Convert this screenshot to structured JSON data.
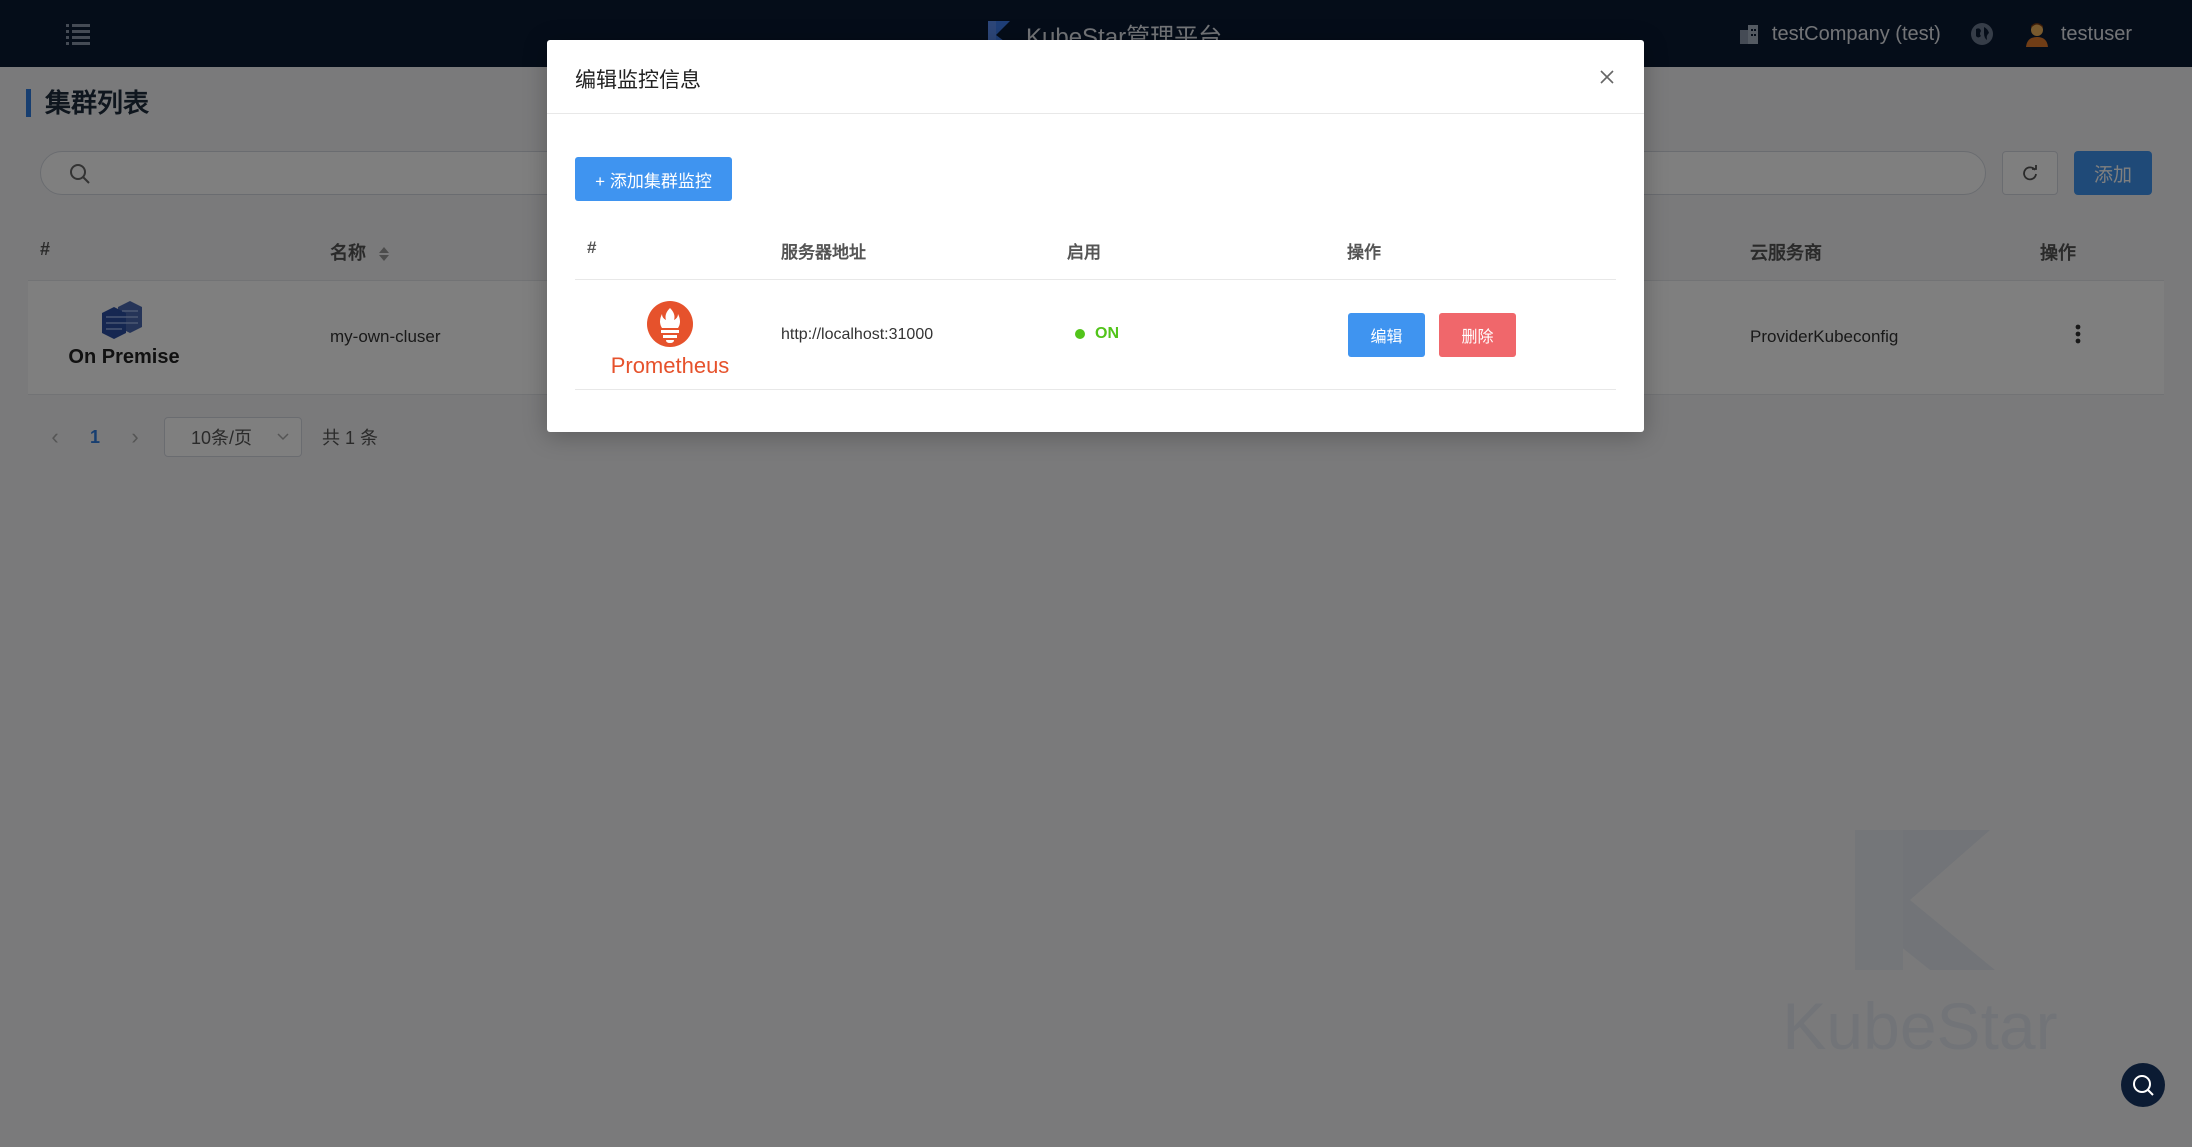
{
  "header": {
    "brand": "KubeStar管理平台",
    "company": "testCompany (test)",
    "user": "testuser"
  },
  "page": {
    "title": "集群列表",
    "search_placeholder": "",
    "add_label": "添加",
    "table": {
      "columns": [
        "#",
        "名称",
        "云服务商",
        "操作"
      ],
      "rows": [
        {
          "logo_text": "On Premise",
          "name": "my-own-cluser",
          "provider": "ProviderKubeconfig"
        }
      ]
    },
    "pager": {
      "prev": "‹",
      "page": "1",
      "next": "›",
      "page_size": "10条/页",
      "total": "共 1 条"
    },
    "watermark": "KubeStar"
  },
  "modal": {
    "title": "编辑监控信息",
    "add_label": "+ 添加集群监控",
    "columns": [
      "#",
      "服务器地址",
      "启用",
      "操作"
    ],
    "rows": [
      {
        "logo_text": "Prometheus",
        "address": "http://localhost:31000",
        "status": "ON",
        "edit_label": "编辑",
        "delete_label": "删除"
      }
    ]
  },
  "colors": {
    "topbar": "#0b1b33",
    "primary": "#3f94f0",
    "danger": "#f0676b",
    "success": "#52c41a",
    "prometheus": "#e6522c"
  },
  "icons": [
    "menu-icon",
    "kubestar-logo",
    "building-icon",
    "globe-icon",
    "user-avatar-icon",
    "search-icon",
    "refresh-icon",
    "sort-icon",
    "more-icon",
    "close-icon",
    "help-search-icon",
    "prometheus-logo",
    "on-premise-logo"
  ]
}
